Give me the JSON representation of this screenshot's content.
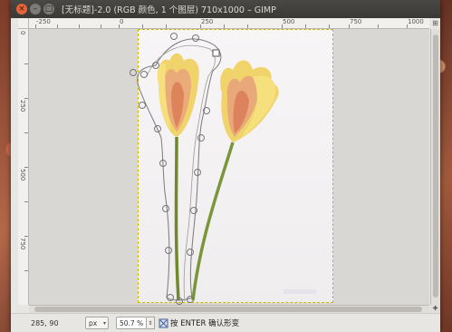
{
  "window": {
    "title": "[无标题]-2.0 (RGB 颜色, 1 个图层) 710x1000 – GIMP",
    "close_glyph": "×",
    "min_glyph": "–",
    "max_glyph": "□"
  },
  "rulers": {
    "top_labels": [
      "-250",
      "0",
      "250",
      "500",
      "750",
      "1000"
    ],
    "left_labels": [
      "0",
      "250",
      "500",
      "750"
    ]
  },
  "canvas": {
    "image_size_text": "710x1000",
    "accent_selection_color": "#c8b800",
    "path_color": "#7a7a7a"
  },
  "statusbar": {
    "coords": "285, 90",
    "unit": "px",
    "unit_arrow": "▾",
    "zoom": "50.7 %",
    "zoom_spin": "⇕",
    "message": "按 ENTER 确认形变"
  },
  "corner": {
    "nav_glyph": "⊞",
    "zoom_glyph": "✚"
  }
}
